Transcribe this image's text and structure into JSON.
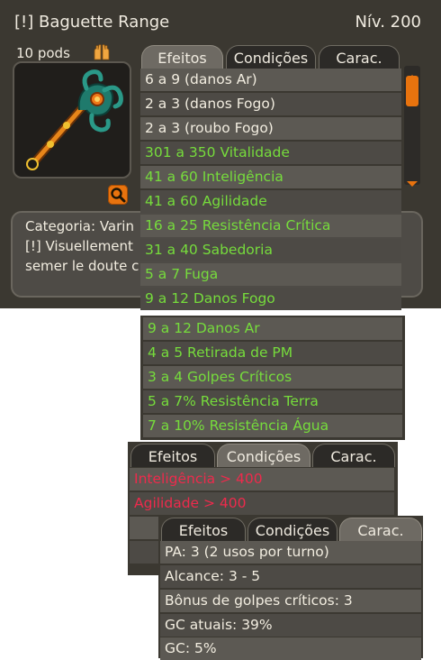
{
  "item": {
    "name": "[!] Baguette Range",
    "level": "Nív. 200",
    "pods": "10 pods",
    "pods_icon": "hands-icon",
    "zoom_icon": "magnifier-icon"
  },
  "tabs": {
    "effects": "Efeitos",
    "conditions": "Condições",
    "characteristics": "Carac."
  },
  "description": {
    "line1": "Categoria: Varin",
    "line2": "[!] Visuellement",
    "line3": "semer le doute c"
  },
  "effects": [
    {
      "text": "6 a 9 (danos Ar)",
      "color": "#f2ede0"
    },
    {
      "text": "2 a 3 (danos Fogo)",
      "color": "#f2ede0"
    },
    {
      "text": "2 a 3 (roubo Fogo)",
      "color": "#f2ede0"
    },
    {
      "text": "301 a 350 Vitalidade",
      "color": "#76dc3c"
    },
    {
      "text": "41 a 60 Inteligência",
      "color": "#76dc3c"
    },
    {
      "text": "41 a 60 Agilidade",
      "color": "#76dc3c"
    },
    {
      "text": "16 a 25 Resistência Crítica",
      "color": "#76dc3c"
    },
    {
      "text": "31 a 40 Sabedoria",
      "color": "#76dc3c"
    },
    {
      "text": "5 a 7 Fuga",
      "color": "#76dc3c"
    },
    {
      "text": "9 a 12 Danos Fogo",
      "color": "#76dc3c"
    },
    {
      "text": "9 a 12 Danos Ar",
      "color": "#76dc3c"
    },
    {
      "text": "4 a 5 Retirada de PM",
      "color": "#76dc3c"
    },
    {
      "text": "3 a 4 Golpes Críticos",
      "color": "#76dc3c"
    },
    {
      "text": "5 a 7% Resistência Terra",
      "color": "#76dc3c"
    },
    {
      "text": "7 a 10% Resistência Água",
      "color": "#76dc3c"
    }
  ],
  "conditions": [
    {
      "text": "Inteligência > 400",
      "color": "#ee2a4c"
    },
    {
      "text": "Agilidade > 400",
      "color": "#ee2a4c"
    }
  ],
  "characteristics": [
    "PA: 3 (2 usos por turno)",
    "Alcance: 3 - 5",
    "Bônus de golpes críticos: 3",
    "GC atuais: 39%",
    "GC: 5%"
  ],
  "colors": {
    "panel": "#3b3831",
    "accent": "#e8730e",
    "bonus_text": "#76dc3c",
    "unmet_condition_text": "#ee2a4c"
  }
}
